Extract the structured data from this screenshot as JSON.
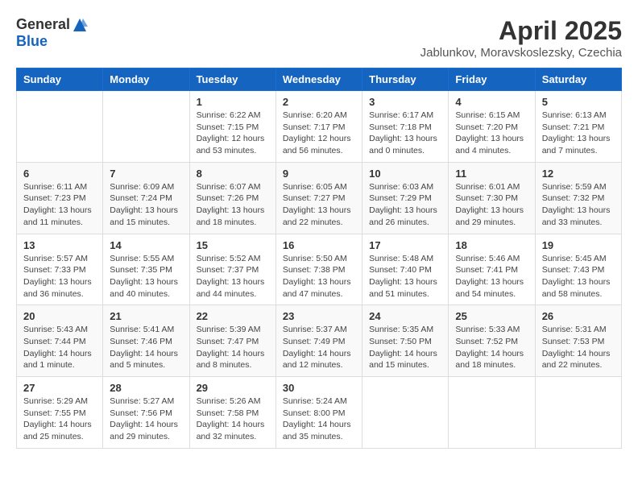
{
  "header": {
    "logo_general": "General",
    "logo_blue": "Blue",
    "title": "April 2025",
    "location": "Jablunkov, Moravskoslezsky, Czechia"
  },
  "weekdays": [
    "Sunday",
    "Monday",
    "Tuesday",
    "Wednesday",
    "Thursday",
    "Friday",
    "Saturday"
  ],
  "weeks": [
    [
      {
        "day": "",
        "info": ""
      },
      {
        "day": "",
        "info": ""
      },
      {
        "day": "1",
        "info": "Sunrise: 6:22 AM\nSunset: 7:15 PM\nDaylight: 12 hours and 53 minutes."
      },
      {
        "day": "2",
        "info": "Sunrise: 6:20 AM\nSunset: 7:17 PM\nDaylight: 12 hours and 56 minutes."
      },
      {
        "day": "3",
        "info": "Sunrise: 6:17 AM\nSunset: 7:18 PM\nDaylight: 13 hours and 0 minutes."
      },
      {
        "day": "4",
        "info": "Sunrise: 6:15 AM\nSunset: 7:20 PM\nDaylight: 13 hours and 4 minutes."
      },
      {
        "day": "5",
        "info": "Sunrise: 6:13 AM\nSunset: 7:21 PM\nDaylight: 13 hours and 7 minutes."
      }
    ],
    [
      {
        "day": "6",
        "info": "Sunrise: 6:11 AM\nSunset: 7:23 PM\nDaylight: 13 hours and 11 minutes."
      },
      {
        "day": "7",
        "info": "Sunrise: 6:09 AM\nSunset: 7:24 PM\nDaylight: 13 hours and 15 minutes."
      },
      {
        "day": "8",
        "info": "Sunrise: 6:07 AM\nSunset: 7:26 PM\nDaylight: 13 hours and 18 minutes."
      },
      {
        "day": "9",
        "info": "Sunrise: 6:05 AM\nSunset: 7:27 PM\nDaylight: 13 hours and 22 minutes."
      },
      {
        "day": "10",
        "info": "Sunrise: 6:03 AM\nSunset: 7:29 PM\nDaylight: 13 hours and 26 minutes."
      },
      {
        "day": "11",
        "info": "Sunrise: 6:01 AM\nSunset: 7:30 PM\nDaylight: 13 hours and 29 minutes."
      },
      {
        "day": "12",
        "info": "Sunrise: 5:59 AM\nSunset: 7:32 PM\nDaylight: 13 hours and 33 minutes."
      }
    ],
    [
      {
        "day": "13",
        "info": "Sunrise: 5:57 AM\nSunset: 7:33 PM\nDaylight: 13 hours and 36 minutes."
      },
      {
        "day": "14",
        "info": "Sunrise: 5:55 AM\nSunset: 7:35 PM\nDaylight: 13 hours and 40 minutes."
      },
      {
        "day": "15",
        "info": "Sunrise: 5:52 AM\nSunset: 7:37 PM\nDaylight: 13 hours and 44 minutes."
      },
      {
        "day": "16",
        "info": "Sunrise: 5:50 AM\nSunset: 7:38 PM\nDaylight: 13 hours and 47 minutes."
      },
      {
        "day": "17",
        "info": "Sunrise: 5:48 AM\nSunset: 7:40 PM\nDaylight: 13 hours and 51 minutes."
      },
      {
        "day": "18",
        "info": "Sunrise: 5:46 AM\nSunset: 7:41 PM\nDaylight: 13 hours and 54 minutes."
      },
      {
        "day": "19",
        "info": "Sunrise: 5:45 AM\nSunset: 7:43 PM\nDaylight: 13 hours and 58 minutes."
      }
    ],
    [
      {
        "day": "20",
        "info": "Sunrise: 5:43 AM\nSunset: 7:44 PM\nDaylight: 14 hours and 1 minute."
      },
      {
        "day": "21",
        "info": "Sunrise: 5:41 AM\nSunset: 7:46 PM\nDaylight: 14 hours and 5 minutes."
      },
      {
        "day": "22",
        "info": "Sunrise: 5:39 AM\nSunset: 7:47 PM\nDaylight: 14 hours and 8 minutes."
      },
      {
        "day": "23",
        "info": "Sunrise: 5:37 AM\nSunset: 7:49 PM\nDaylight: 14 hours and 12 minutes."
      },
      {
        "day": "24",
        "info": "Sunrise: 5:35 AM\nSunset: 7:50 PM\nDaylight: 14 hours and 15 minutes."
      },
      {
        "day": "25",
        "info": "Sunrise: 5:33 AM\nSunset: 7:52 PM\nDaylight: 14 hours and 18 minutes."
      },
      {
        "day": "26",
        "info": "Sunrise: 5:31 AM\nSunset: 7:53 PM\nDaylight: 14 hours and 22 minutes."
      }
    ],
    [
      {
        "day": "27",
        "info": "Sunrise: 5:29 AM\nSunset: 7:55 PM\nDaylight: 14 hours and 25 minutes."
      },
      {
        "day": "28",
        "info": "Sunrise: 5:27 AM\nSunset: 7:56 PM\nDaylight: 14 hours and 29 minutes."
      },
      {
        "day": "29",
        "info": "Sunrise: 5:26 AM\nSunset: 7:58 PM\nDaylight: 14 hours and 32 minutes."
      },
      {
        "day": "30",
        "info": "Sunrise: 5:24 AM\nSunset: 8:00 PM\nDaylight: 14 hours and 35 minutes."
      },
      {
        "day": "",
        "info": ""
      },
      {
        "day": "",
        "info": ""
      },
      {
        "day": "",
        "info": ""
      }
    ]
  ]
}
